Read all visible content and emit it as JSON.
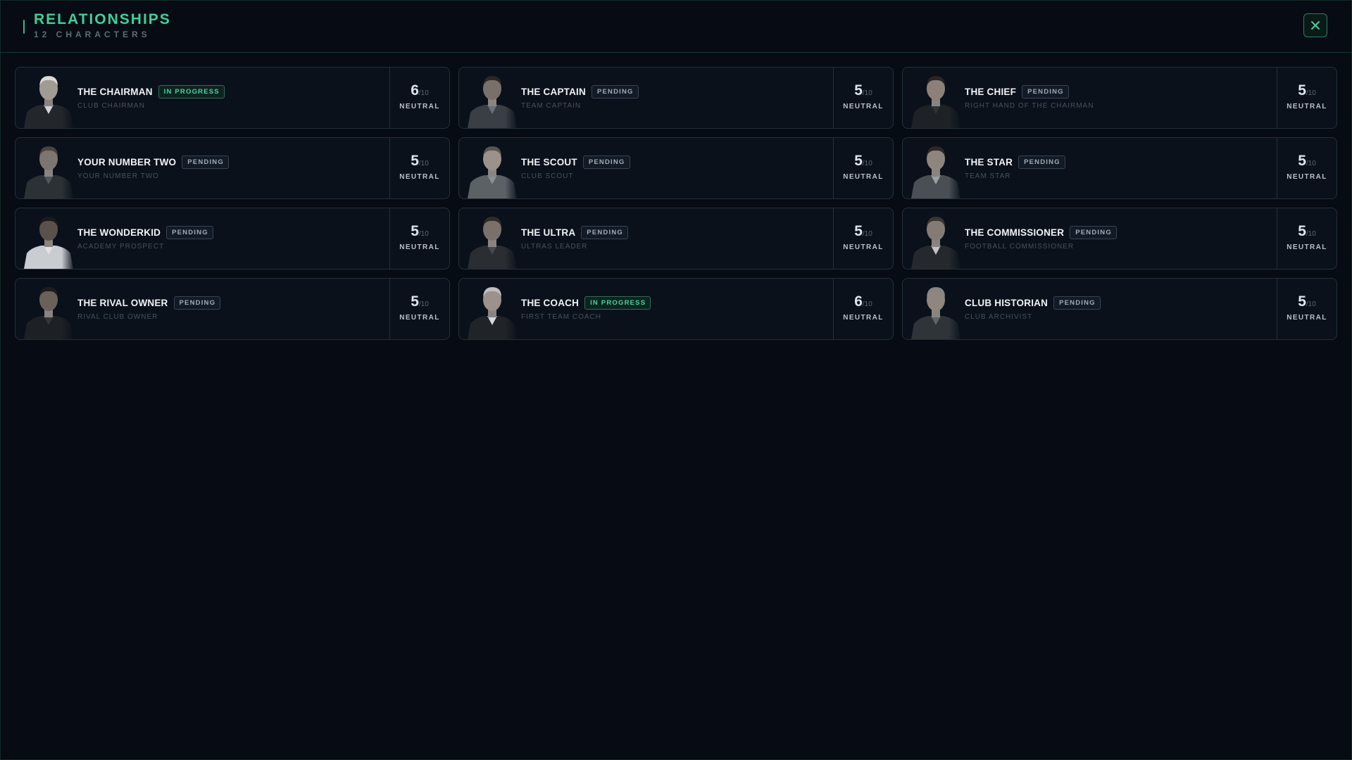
{
  "header": {
    "title": "RELATIONSHIPS",
    "subtitle": "12 CHARACTERS",
    "close_icon": "close-icon"
  },
  "colors": {
    "accent": "#3dd19a",
    "background": "#060b14",
    "card": "#0a111b",
    "in_progress": "#49d39f",
    "pending": "#a2acb6"
  },
  "characters": [
    {
      "name": "THE CHAIRMAN",
      "status": "IN PROGRESS",
      "role": "CLUB CHAIRMAN",
      "score": "6",
      "max": "/10",
      "mood": "NEUTRAL"
    },
    {
      "name": "THE CAPTAIN",
      "status": "PENDING",
      "role": "TEAM CAPTAIN",
      "score": "5",
      "max": "/10",
      "mood": "NEUTRAL"
    },
    {
      "name": "THE CHIEF",
      "status": "PENDING",
      "role": "RIGHT HAND OF THE CHAIRMAN",
      "score": "5",
      "max": "/10",
      "mood": "NEUTRAL"
    },
    {
      "name": "YOUR NUMBER TWO",
      "status": "PENDING",
      "role": "YOUR NUMBER TWO",
      "score": "5",
      "max": "/10",
      "mood": "NEUTRAL"
    },
    {
      "name": "THE SCOUT",
      "status": "PENDING",
      "role": "CLUB SCOUT",
      "score": "5",
      "max": "/10",
      "mood": "NEUTRAL"
    },
    {
      "name": "THE STAR",
      "status": "PENDING",
      "role": "TEAM STAR",
      "score": "5",
      "max": "/10",
      "mood": "NEUTRAL"
    },
    {
      "name": "THE WONDERKID",
      "status": "PENDING",
      "role": "ACADEMY PROSPECT",
      "score": "5",
      "max": "/10",
      "mood": "NEUTRAL"
    },
    {
      "name": "THE ULTRA",
      "status": "PENDING",
      "role": "ULTRAS LEADER",
      "score": "5",
      "max": "/10",
      "mood": "NEUTRAL"
    },
    {
      "name": "THE COMMISSIONER",
      "status": "PENDING",
      "role": "FOOTBALL COMMISSIONER",
      "score": "5",
      "max": "/10",
      "mood": "NEUTRAL"
    },
    {
      "name": "THE RIVAL OWNER",
      "status": "PENDING",
      "role": "RIVAL CLUB OWNER",
      "score": "5",
      "max": "/10",
      "mood": "NEUTRAL"
    },
    {
      "name": "THE COACH",
      "status": "IN PROGRESS",
      "role": "FIRST TEAM COACH",
      "score": "6",
      "max": "/10",
      "mood": "NEUTRAL"
    },
    {
      "name": "CLUB HISTORIAN",
      "status": "PENDING",
      "role": "CLUB ARCHIVIST",
      "score": "5",
      "max": "/10",
      "mood": "NEUTRAL"
    }
  ]
}
